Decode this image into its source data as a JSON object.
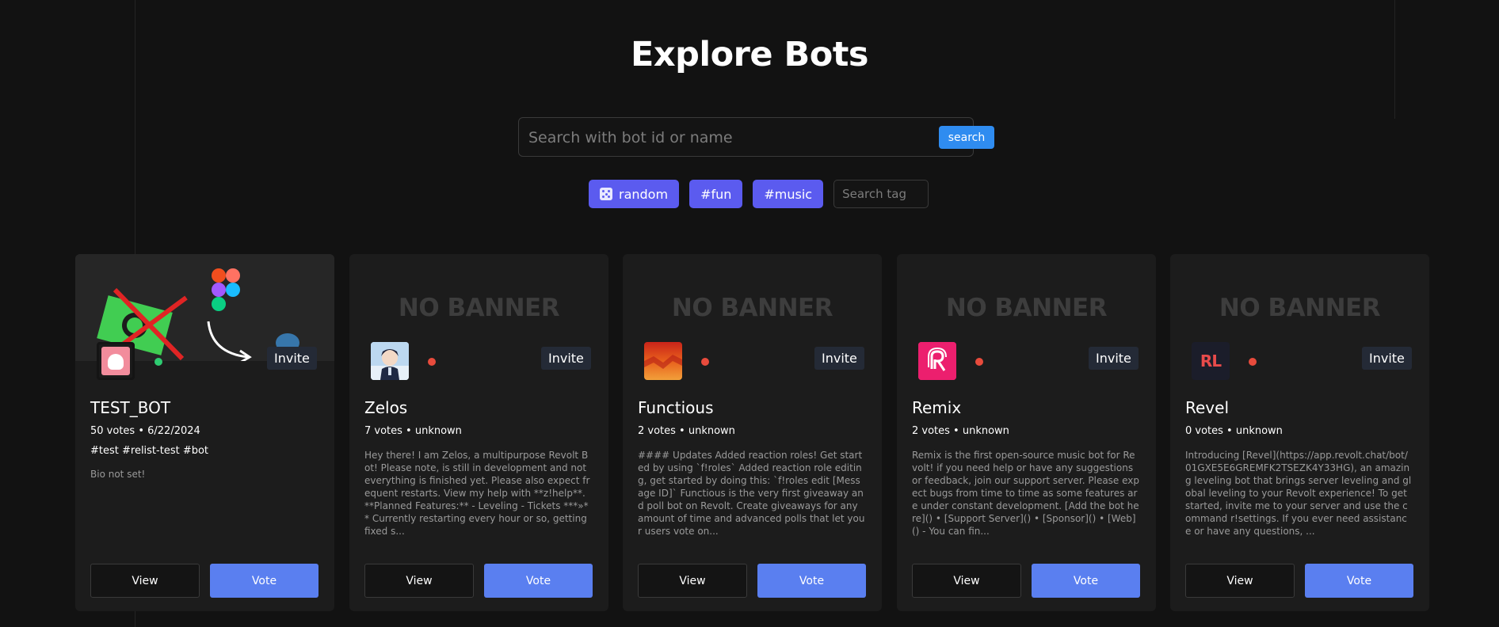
{
  "page": {
    "title": "Explore Bots"
  },
  "search": {
    "placeholder": "Search with bot id or name",
    "button_label": "search"
  },
  "tags": {
    "random_label": "random",
    "items": [
      "#fun",
      "#music"
    ],
    "tag_search_placeholder": "Search tag"
  },
  "colors": {
    "accent": "#5b5bef",
    "vote": "#5a7ff0",
    "search_button": "#2f8cf0",
    "offline": "#e84b3c",
    "online": "#2ecc71"
  },
  "cards": [
    {
      "name": "TEST_BOT",
      "meta": "50 votes • 6/22/2024",
      "tags": "#test #relist-test #bot",
      "bio": "Bio not set!",
      "status": "online",
      "invite_label": "Invite",
      "view_label": "View",
      "vote_label": "Vote"
    },
    {
      "name": "Zelos",
      "meta": "7 votes • unknown",
      "banner": "NO BANNER",
      "description": "Hey there! I am Zelos, a multipurpose Revolt Bot! Please note, is still in development and not everything is finished yet. Please also expect frequent restarts. View my help with **z!help**. **Planned Features:** - Leveling - Tickets ***»** Currently restarting every hour or so, getting fixed s...",
      "status": "offline",
      "invite_label": "Invite",
      "view_label": "View",
      "vote_label": "Vote"
    },
    {
      "name": "Functious",
      "meta": "2 votes • unknown",
      "banner": "NO BANNER",
      "description": "#### Updates Added reaction roles! Get started by using `f!roles` Added reaction role editing, get started by doing this: `f!roles edit [Message ID]` Functious is the very first giveaway and poll bot on Revolt. Create giveaways for any amount of time and advanced polls that let your users vote on...",
      "status": "offline",
      "invite_label": "Invite",
      "view_label": "View",
      "vote_label": "Vote"
    },
    {
      "name": "Remix",
      "meta": "2 votes • unknown",
      "banner": "NO BANNER",
      "description": "Remix is the first open-source music bot for Revolt! if you need help or have any suggestions or feedback, join our support server. Please expect bugs from time to time as some features are under constant development.  [Add the bot here]() • [Support Server]() • [Sponsor]() • [Web]() - You can fin...",
      "status": "offline",
      "invite_label": "Invite",
      "view_label": "View",
      "vote_label": "Vote"
    },
    {
      "name": "Revel",
      "meta": "0 votes • unknown",
      "banner": "NO BANNER",
      "description": "Introducing [Revel](https://app.revolt.chat/bot/01GXE5E6GREMFK2TSEZK4Y33HG), an amazing leveling bot that brings server leveling and global leveling to your Revolt experience! To get started, invite me to your server and use the command r!settings. If you ever need assistance or have any questions, ...",
      "avatar_text": "RL",
      "status": "offline",
      "invite_label": "Invite",
      "view_label": "View",
      "vote_label": "Vote"
    }
  ]
}
